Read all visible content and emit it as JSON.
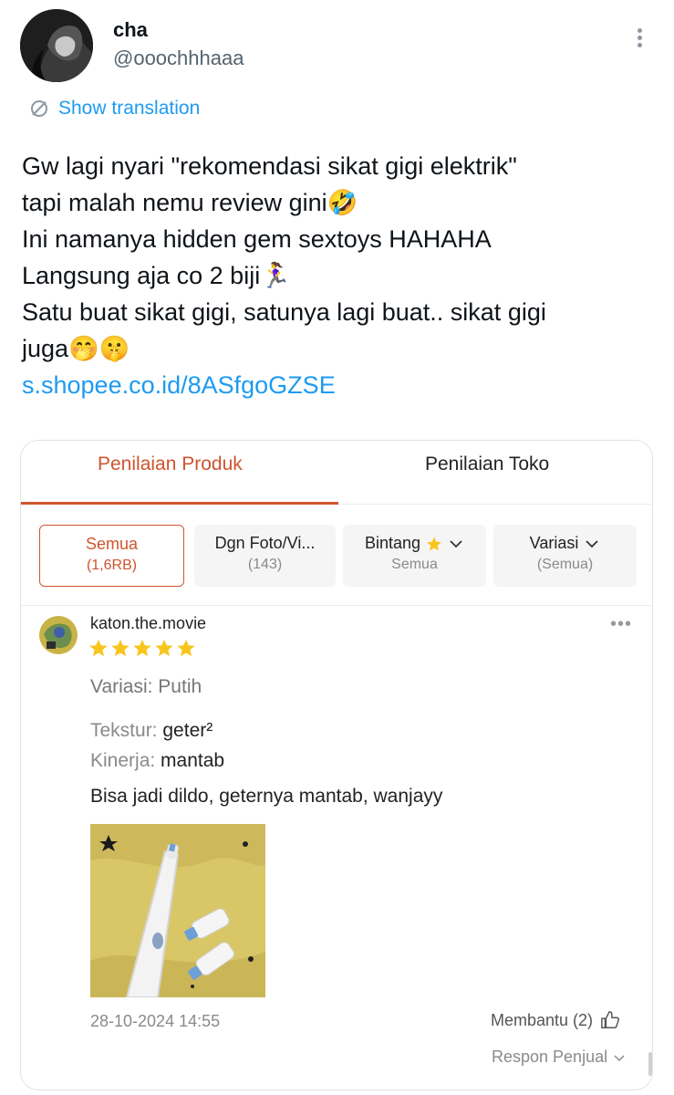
{
  "tweet": {
    "author_name": "cha",
    "author_handle": "@ooochhhaaa",
    "translate_label": "Show translation",
    "lines": [
      "Gw lagi nyari \"rekomendasi sikat gigi elektrik\"",
      "tapi malah nemu review gini🤣",
      "Ini namanya hidden gem sextoys HAHAHA",
      "Langsung aja co 2 biji🏃‍♀️",
      "Satu buat sikat gigi, satunya lagi buat.. sikat gigi",
      "juga🤭🤫"
    ],
    "link": "s.shopee.co.id/8ASfgoGZSE"
  },
  "card": {
    "tabs": [
      "Penilaian Produk",
      "Penilaian Toko"
    ],
    "filters": [
      {
        "label": "Semua",
        "sub": "(1,6RB)"
      },
      {
        "label": "Dgn Foto/Vi...",
        "sub": "(143)"
      },
      {
        "label": "Bintang",
        "sub": "Semua"
      },
      {
        "label": "Variasi",
        "sub": "(Semua)"
      }
    ],
    "review": {
      "username": "katon.the.movie",
      "rating": 5,
      "variation": "Variasi: Putih",
      "texture_label": "Tekstur:",
      "texture_value": "geter²",
      "performance_label": "Kinerja:",
      "performance_value": "mantab",
      "comment": "Bisa jadi dildo, geternya mantab, wanjayy",
      "date": "28-10-2024 14:55",
      "helpful": "Membantu (2)",
      "seller_response": "Respon Penjual"
    }
  },
  "colors": {
    "link_blue": "#1d9bf0",
    "shopee_orange": "#d0542e",
    "star_yellow": "#f8c51c"
  },
  "icons": [
    "more-vertical-icon",
    "translate-icon",
    "star-icon",
    "chevron-down-icon",
    "more-horizontal-icon",
    "thumbs-up-icon"
  ]
}
